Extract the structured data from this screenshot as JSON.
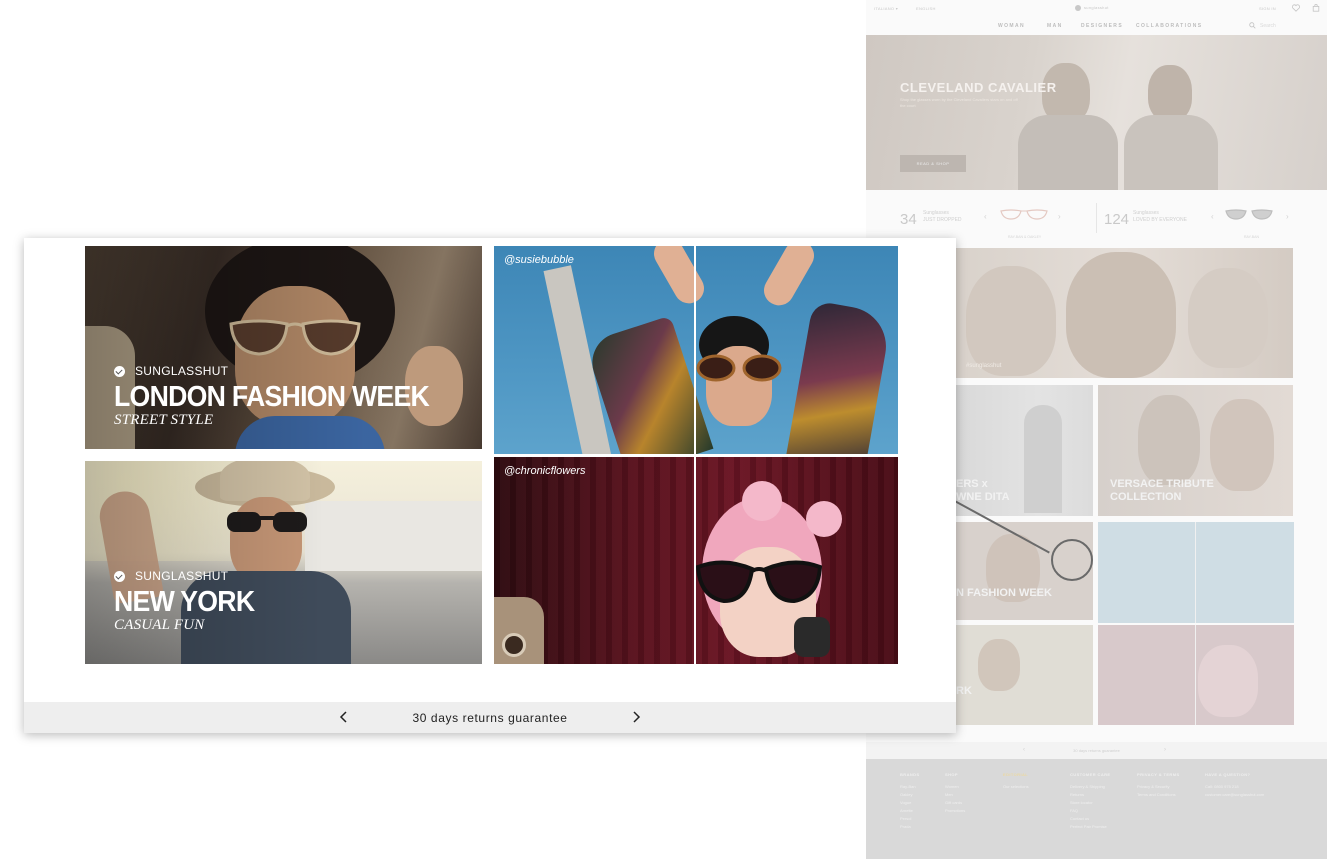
{
  "background_page": {
    "topbar": {
      "country": "ITALIANO ▾",
      "language": "ENGLISH",
      "logo": "sunglasshut",
      "signin": "SIGN IN"
    },
    "nav": [
      "WOMAN",
      "MAN",
      "DESIGNERS",
      "COLLABORATIONS"
    ],
    "search_placeholder": "Search",
    "hero": {
      "title": "CLEVELAND CAVALIER",
      "subtitle": "Shop the glasses worn by the Cleveland Cavaliers stars on and off the court",
      "button": "READ & SHOP"
    },
    "stats": [
      {
        "number": "34",
        "line1": "Sunglasses",
        "line2": "JUST DROPPED",
        "caption": "RAY-BAN & OAKLEY"
      },
      {
        "number": "124",
        "line1": "Sunglasses",
        "line2": "LOVED BY EVERYONE",
        "caption": "RAY-BAN"
      }
    ],
    "banner_caption": "#sunglasshut",
    "tiles": [
      {
        "text": "ERS x\nWNE DITA"
      },
      {
        "text": "VERSACE TRIBUTE\nCOLLECTION"
      },
      {
        "text": "N FASHION WEEK"
      },
      {
        "text": "@susiebubble"
      },
      {
        "text": "RK"
      },
      {
        "text": "@chronicflowers"
      }
    ],
    "returns": "30 days returns guarantee",
    "footer": [
      {
        "heading": "BRANDS",
        "items": [
          "Ray-Ban",
          "Oakley",
          "Vogue",
          "Arnette",
          "Persol",
          "Prada"
        ]
      },
      {
        "heading": "SHOP",
        "items": [
          "Women",
          "Men",
          "Gift cards",
          "Promotions"
        ]
      },
      {
        "heading": "EDITORIAL",
        "items": [
          "Our selections"
        ]
      },
      {
        "heading": "CUSTOMER CARE",
        "items": [
          "Delivery & Shipping",
          "Returns",
          "Store locator",
          "FAQ",
          "Contact us",
          "Perfect Pair Promise"
        ]
      },
      {
        "heading": "PRIVACY & TERMS",
        "items": [
          "Privacy & Security",
          "Terms and Conditions"
        ]
      },
      {
        "heading": "HAVE A QUESTION?",
        "items": [
          "Call: 0800 975 218",
          "customer.care@sunglasshut.com"
        ]
      }
    ]
  },
  "zoom_panel": {
    "tiles": [
      {
        "brand": "SUNGLASSHUT",
        "title": "LONDON FASHION WEEK",
        "subtitle": "STREET STYLE"
      },
      {
        "handle": "@susiebubble"
      },
      {
        "brand": "SUNGLASSHUT",
        "title": "NEW YORK",
        "subtitle": "CASUAL FUN"
      },
      {
        "handle": "@chronicflowers"
      }
    ],
    "bar": {
      "text": "30 days returns guarantee",
      "prev_icon": "chevron-left-icon",
      "next_icon": "chevron-right-icon"
    }
  },
  "colors": {
    "accent_footer_highlight": "#ebd9a3",
    "bar_bg": "#eeeeee"
  }
}
